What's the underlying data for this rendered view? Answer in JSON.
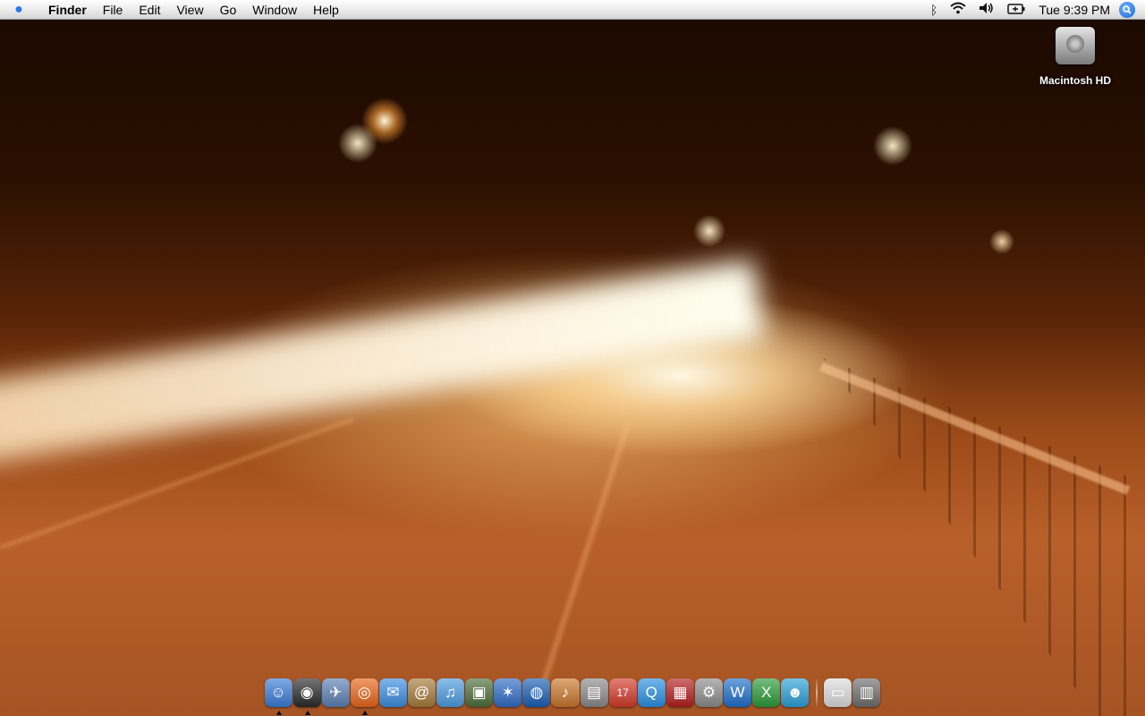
{
  "menubar": {
    "app_name": "Finder",
    "menus": [
      "File",
      "Edit",
      "View",
      "Go",
      "Window",
      "Help"
    ],
    "clock": "Tue 9:39 PM"
  },
  "status_icons": [
    "bluetooth-icon",
    "wifi-icon",
    "volume-icon",
    "battery-icon"
  ],
  "desktop": {
    "icons": [
      {
        "label": "Macintosh HD",
        "icon": "hard-drive-icon"
      }
    ]
  },
  "dock": {
    "apps": [
      {
        "icon": "finder-icon",
        "glyph": "☺",
        "color": "#3a7bd5",
        "running": true
      },
      {
        "icon": "dashboard-icon",
        "glyph": "◉",
        "color": "#2a2a2a",
        "running": true
      },
      {
        "icon": "mail-icon",
        "glyph": "✈",
        "color": "#5b7fb3",
        "running": false
      },
      {
        "icon": "firefox-icon",
        "glyph": "◎",
        "color": "#e8661a",
        "running": true
      },
      {
        "icon": "ichat-icon",
        "glyph": "✉",
        "color": "#3b8de0",
        "running": false
      },
      {
        "icon": "address-book-icon",
        "glyph": "@",
        "color": "#a57a3a",
        "running": false
      },
      {
        "icon": "itunes-icon",
        "glyph": "♫",
        "color": "#4c9be0",
        "running": false
      },
      {
        "icon": "iphoto-icon",
        "glyph": "▣",
        "color": "#4d6e3a",
        "running": false
      },
      {
        "icon": "imovie-icon",
        "glyph": "✶",
        "color": "#2f6bc4",
        "running": false
      },
      {
        "icon": "idvd-icon",
        "glyph": "◍",
        "color": "#1a5fb4",
        "running": false
      },
      {
        "icon": "garageband-icon",
        "glyph": "♪",
        "color": "#c9772d",
        "running": false
      },
      {
        "icon": "iweb-icon",
        "glyph": "▤",
        "color": "#8a8a8a",
        "running": false
      },
      {
        "icon": "ical-icon",
        "glyph": "17",
        "color": "#d33a2a",
        "running": false
      },
      {
        "icon": "quicktime-icon",
        "glyph": "Q",
        "color": "#2a8fe0",
        "running": false
      },
      {
        "icon": "photo-booth-icon",
        "glyph": "▦",
        "color": "#b21f1f",
        "running": false
      },
      {
        "icon": "system-preferences-icon",
        "glyph": "⚙",
        "color": "#8c8c8c",
        "running": false
      },
      {
        "icon": "word-icon",
        "glyph": "W",
        "color": "#1f6fc9",
        "running": false
      },
      {
        "icon": "excel-icon",
        "glyph": "X",
        "color": "#2c9a3a",
        "running": false
      },
      {
        "icon": "messenger-icon",
        "glyph": "☻",
        "color": "#2ba0d8",
        "running": false
      }
    ],
    "stacks": [
      {
        "icon": "downloads-stack-icon",
        "glyph": "▭",
        "color": "#dcdcdc"
      },
      {
        "icon": "trash-icon",
        "glyph": "▥",
        "color": "#6e6e6e"
      }
    ]
  }
}
